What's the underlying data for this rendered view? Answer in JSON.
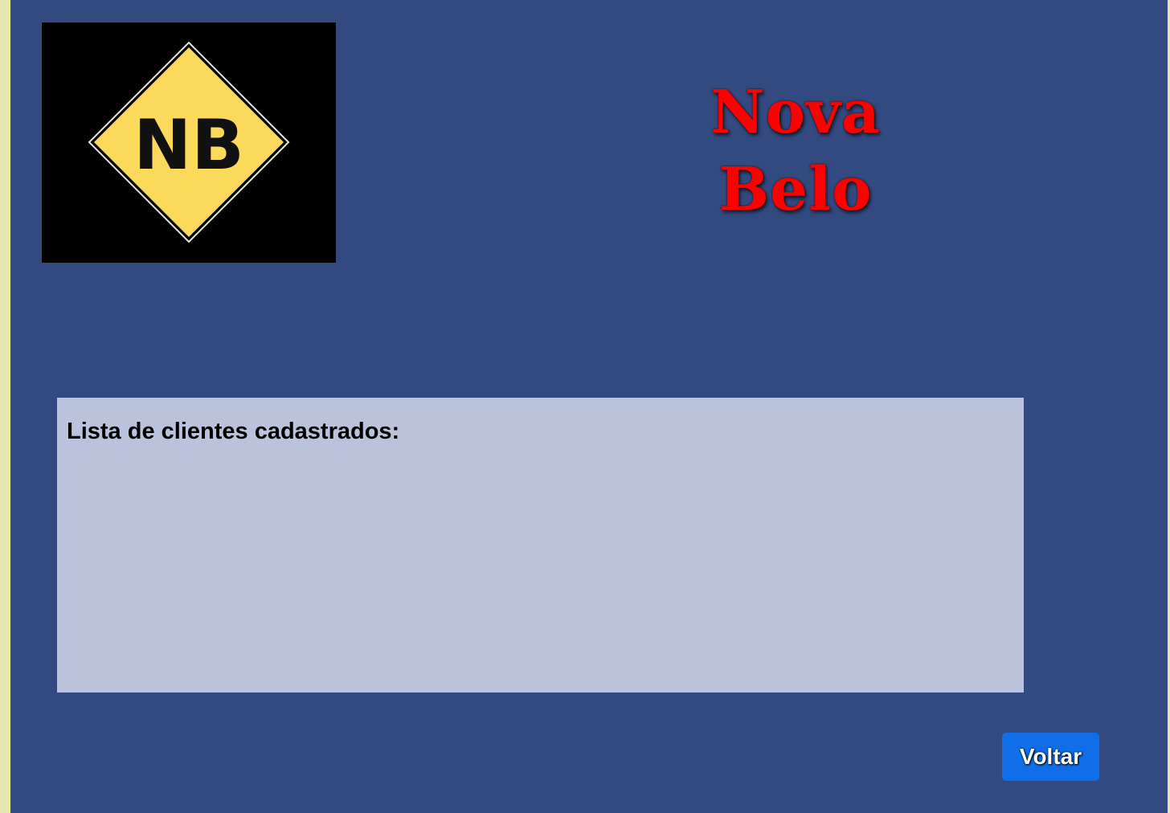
{
  "colors": {
    "background": "#324a80",
    "side_strip": "#e8e6b0",
    "logo_background": "#000000",
    "logo_diamond": "#fbd95a",
    "title": "#ff0000",
    "panel": "#bbc3dc",
    "button": "#0f6ee8",
    "button_text": "#ffffff"
  },
  "logo": {
    "text": "NB",
    "icon": "diamond-sign-logo"
  },
  "header": {
    "title": "Nova Belo"
  },
  "client_panel": {
    "heading": "Lista de clientes cadastrados:",
    "clients": []
  },
  "actions": {
    "back_label": "Voltar"
  }
}
